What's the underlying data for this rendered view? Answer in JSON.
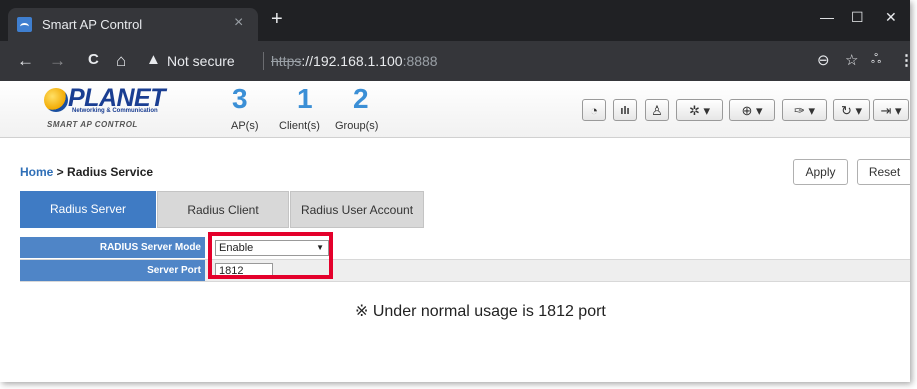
{
  "browser": {
    "tab_title": "Smart AP Control",
    "tab_close": "×",
    "new_tab": "+",
    "minimize": "—",
    "maximize": "☐",
    "close": "✕",
    "back": "←",
    "forward": "→",
    "reload": "C",
    "home": "⌂",
    "warning_icon": "▲",
    "not_secure": "Not secure",
    "url_scheme": "https",
    "url_host": "://192.168.1.100",
    "url_port": ":8888",
    "zoom_icon": "⊖",
    "star_icon": "☆",
    "extension_icon": "ஃ",
    "menu_icon": "⋮"
  },
  "app": {
    "logo_word": "PLANET",
    "logo_tag": "Networking & Communication",
    "logo_sub": "SMART AP CONTROL",
    "stats": [
      {
        "value": "3",
        "label": "AP(s)"
      },
      {
        "value": "1",
        "label": "Client(s)"
      },
      {
        "value": "2",
        "label": "Group(s)"
      }
    ],
    "header_buttons": [
      {
        "icon": "dashboard-icon",
        "glyph": "◔"
      },
      {
        "icon": "chart-icon",
        "glyph": "ılı"
      },
      {
        "icon": "user-icon",
        "glyph": "♙"
      },
      {
        "icon": "gear-icon",
        "glyph": "✲ ▾"
      },
      {
        "icon": "globe-icon",
        "glyph": "⊕ ▾"
      },
      {
        "icon": "wrench-icon",
        "glyph": "✑ ▾"
      },
      {
        "icon": "refresh-icon",
        "glyph": "↻ ▾"
      },
      {
        "icon": "logout-icon",
        "glyph": "⇥ ▾"
      }
    ]
  },
  "breadcrumb": {
    "home": "Home",
    "separator": " > ",
    "current": "Radius Service"
  },
  "actions": {
    "apply": "Apply",
    "reset": "Reset"
  },
  "tabs": [
    {
      "label": "Radius Server",
      "active": true
    },
    {
      "label": "Radius Client",
      "active": false
    },
    {
      "label": "Radius User Account",
      "active": false
    }
  ],
  "form": {
    "mode_label": "RADIUS Server Mode",
    "mode_value": "Enable",
    "mode_arrow": "▼",
    "port_label": "Server Port",
    "port_value": "1812"
  },
  "note": "※ Under normal usage is 1812 port",
  "colors": {
    "accent": "#3f7bc4",
    "highlight": "#e4002b"
  }
}
